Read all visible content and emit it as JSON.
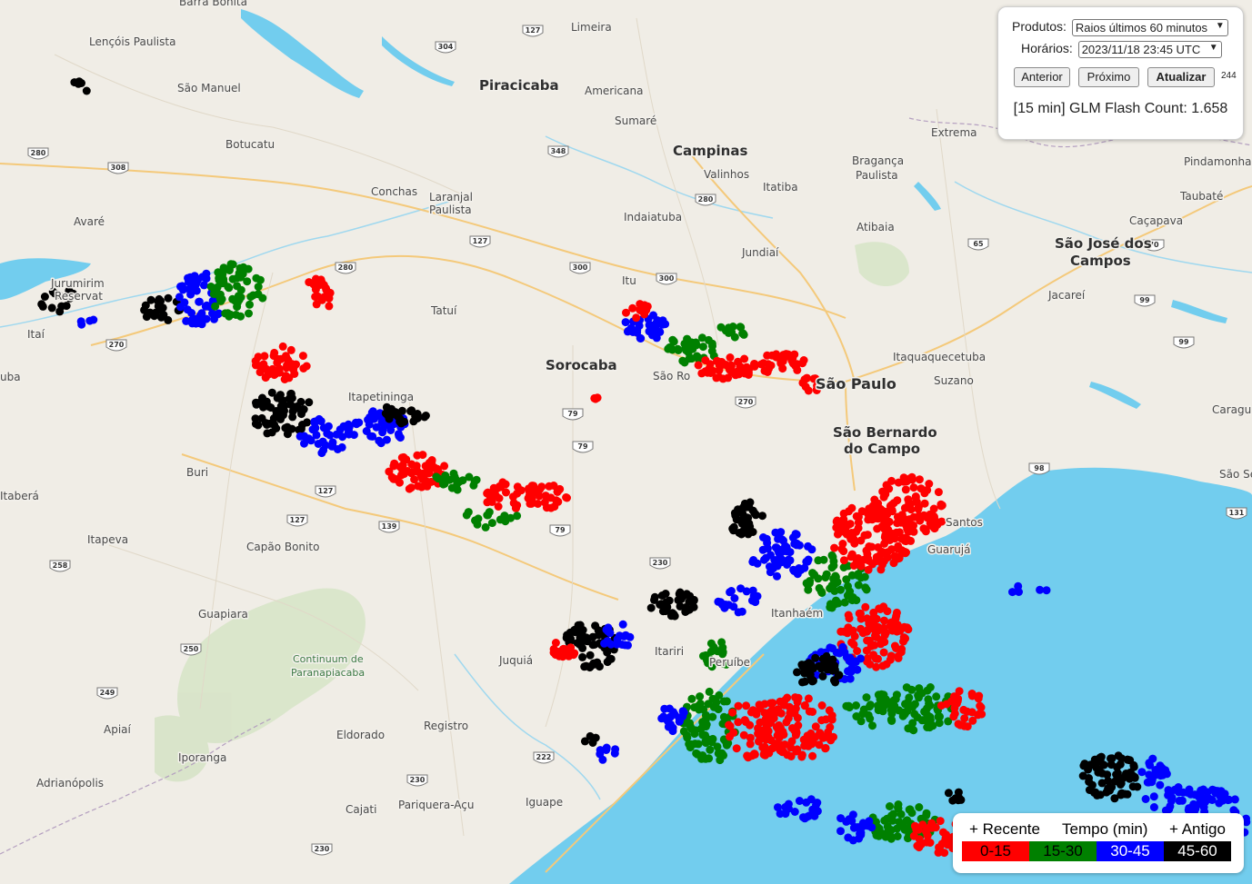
{
  "panel": {
    "produtos_label": "Produtos:",
    "produtos_value": "Raios últimos 60 minutos",
    "horarios_label": "Horários:",
    "horarios_value": "2023/11/18 23:45 UTC",
    "btn_anterior": "Anterior",
    "btn_proximo": "Próximo",
    "btn_atualizar": "Atualizar",
    "counter": "244",
    "flash_count": "[15 min] GLM Flash Count: 1.658"
  },
  "legend": {
    "recente": "+ Recente",
    "tempo": "Tempo (min)",
    "antigo": "+ Antigo",
    "bins": [
      {
        "label": "0-15",
        "color": "#ff0000",
        "text_color": "#000000"
      },
      {
        "label": "15-30",
        "color": "#008000",
        "text_color": "#000000"
      },
      {
        "label": "30-45",
        "color": "#0000ff",
        "text_color": "#ffffff"
      },
      {
        "label": "45-60",
        "color": "#000000",
        "text_color": "#ffffff"
      }
    ]
  },
  "places": [
    {
      "name": "Barra Bonita",
      "size": "normal"
    },
    {
      "name": "Lençóis Paulista",
      "size": "normal"
    },
    {
      "name": "São Manuel",
      "size": "normal"
    },
    {
      "name": "Botucatu",
      "size": "normal"
    },
    {
      "name": "Conchas",
      "size": "normal"
    },
    {
      "name": "Laranjal",
      "size": "normal"
    },
    {
      "name": "Paulista",
      "size": "normal"
    },
    {
      "name": "Avaré",
      "size": "normal"
    },
    {
      "name": "Itaí",
      "size": "normal"
    },
    {
      "name": "Tatuí",
      "size": "normal"
    },
    {
      "name": "Itapetininga",
      "size": "normal"
    },
    {
      "name": "Buri",
      "size": "normal"
    },
    {
      "name": "Itaberá",
      "size": "normal"
    },
    {
      "name": "Itapeva",
      "size": "normal"
    },
    {
      "name": "Capão Bonito",
      "size": "normal"
    },
    {
      "name": "Guapiara",
      "size": "normal"
    },
    {
      "name": "Continuum de",
      "size": "park"
    },
    {
      "name": "Paranapiacaba",
      "size": "park"
    },
    {
      "name": "Apiaí",
      "size": "normal"
    },
    {
      "name": "Iporanga",
      "size": "normal"
    },
    {
      "name": "Adrianópolis",
      "size": "normal"
    },
    {
      "name": "Eldorado",
      "size": "normal"
    },
    {
      "name": "Registro",
      "size": "normal"
    },
    {
      "name": "Cajati",
      "size": "normal"
    },
    {
      "name": "Pariquera-Açu",
      "size": "normal"
    },
    {
      "name": "Iguape",
      "size": "normal"
    },
    {
      "name": "Juquiá",
      "size": "normal"
    },
    {
      "name": "Itariri",
      "size": "normal"
    },
    {
      "name": "Limeira",
      "size": "normal"
    },
    {
      "name": "Piracicaba",
      "size": "city"
    },
    {
      "name": "Americana",
      "size": "normal"
    },
    {
      "name": "Sumaré",
      "size": "normal"
    },
    {
      "name": "Campinas",
      "size": "city"
    },
    {
      "name": "Valinhos",
      "size": "normal"
    },
    {
      "name": "Indaiatuba",
      "size": "normal"
    },
    {
      "name": "Itatiba",
      "size": "normal"
    },
    {
      "name": "Jundiaí",
      "size": "normal"
    },
    {
      "name": "Itu",
      "size": "normal"
    },
    {
      "name": "Sorocaba",
      "size": "city"
    },
    {
      "name": "São Ro",
      "size": "normal"
    },
    {
      "name": "São Paulo",
      "size": "big"
    },
    {
      "name": "São Bernardo",
      "size": "city"
    },
    {
      "name": "do Campo",
      "size": "city"
    },
    {
      "name": "Santos",
      "size": "normal"
    },
    {
      "name": "Guarujá",
      "size": "normal"
    },
    {
      "name": "Itanhaém",
      "size": "normal"
    },
    {
      "name": "Peruíbe",
      "size": "normal"
    },
    {
      "name": "Extrema",
      "size": "normal"
    },
    {
      "name": "Bragança",
      "size": "normal"
    },
    {
      "name": "Paulista",
      "size": "normal"
    },
    {
      "name": "Atibaia",
      "size": "normal"
    },
    {
      "name": "São José dos",
      "size": "city"
    },
    {
      "name": "Campos",
      "size": "city"
    },
    {
      "name": "Jacareí",
      "size": "normal"
    },
    {
      "name": "Caçapava",
      "size": "normal"
    },
    {
      "name": "Taubaté",
      "size": "normal"
    },
    {
      "name": "Pindamonha",
      "size": "normal"
    },
    {
      "name": "Itaquaquecetuba",
      "size": "normal"
    },
    {
      "name": "Suzano",
      "size": "normal"
    },
    {
      "name": "Caragu",
      "size": "normal"
    },
    {
      "name": "São Se",
      "size": "normal"
    },
    {
      "name": "Jurumirim",
      "size": "normal"
    },
    {
      "name": "Reservat",
      "size": "normal"
    },
    {
      "name": "uba",
      "size": "normal"
    }
  ],
  "road_shields": [
    "304",
    "127",
    "280",
    "308",
    "348",
    "280",
    "127",
    "300",
    "300",
    "280",
    "270",
    "270",
    "79",
    "79",
    "79",
    "127",
    "127",
    "139",
    "258",
    "250",
    "249",
    "230",
    "222",
    "230",
    "230",
    "65",
    "70",
    "99",
    "99",
    "98",
    "131"
  ]
}
